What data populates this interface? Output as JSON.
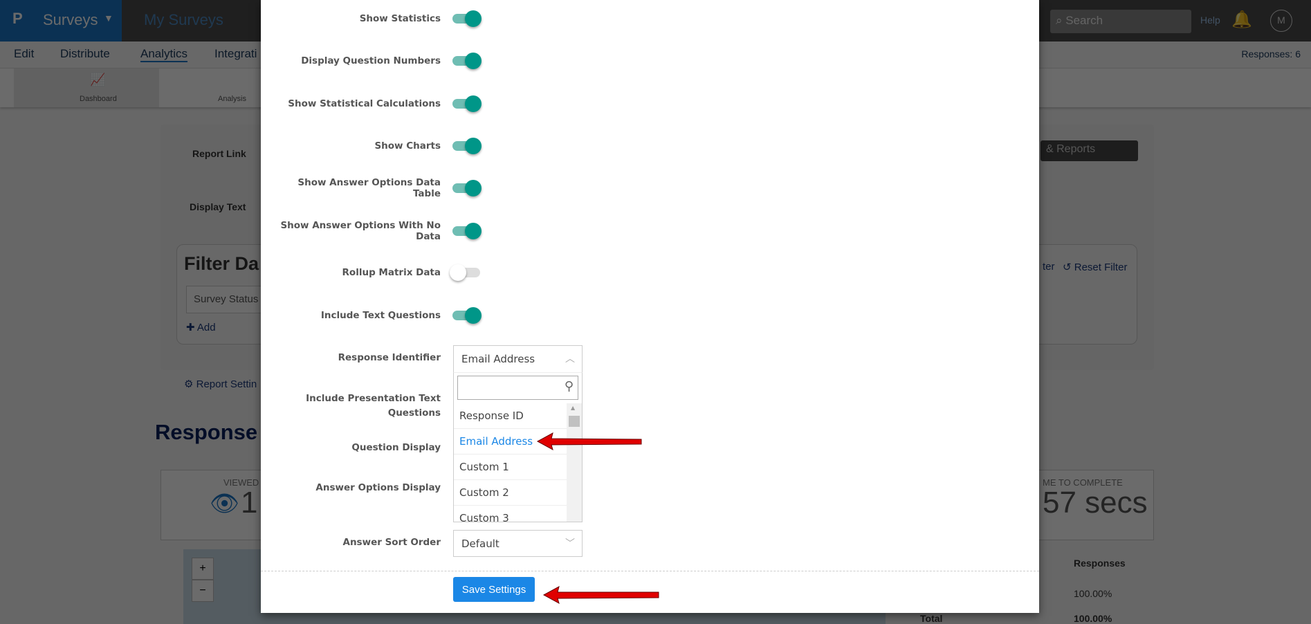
{
  "background": {
    "brand": "Surveys",
    "breadcrumb": "My Surveys",
    "search_placeholder": "Search",
    "help": "Help",
    "avatar": "M",
    "nav": [
      "Edit",
      "Distribute",
      "Analytics",
      "Integrati"
    ],
    "responses_count": "Responses: 6",
    "tools": [
      "Dashboard",
      "Analysis"
    ],
    "report_link_label": "Report Link",
    "display_text_label": "Display Text",
    "reports_button": "& Reports",
    "filter_title": "Filter Da",
    "survey_status": "Survey Status",
    "add": "Add",
    "reset_filter": "Reset Filter",
    "filter_partial": "ter",
    "report_settings": "Report Settin",
    "responses_heading": "Response",
    "viewed_label": "VIEWED",
    "viewed_value": "1",
    "time_label": "ME TO COMPLETE",
    "time_value": "57 secs",
    "table_header": "Responses",
    "table_value": "100.00%",
    "total_label": "Total",
    "total_value": "100.00%"
  },
  "modal": {
    "toggles": [
      {
        "label": "Show Statistics",
        "on": true
      },
      {
        "label": "Display Question Numbers",
        "on": true
      },
      {
        "label": "Show Statistical Calculations",
        "on": true
      },
      {
        "label": "Show Charts",
        "on": true
      },
      {
        "label": "Show Answer Options Data Table",
        "on": true
      },
      {
        "label": "Show Answer Options With No Data",
        "on": true
      },
      {
        "label": "Rollup Matrix Data",
        "on": false
      },
      {
        "label": "Include Text Questions",
        "on": true
      }
    ],
    "response_identifier": {
      "label": "Response Identifier",
      "value": "Email Address",
      "search_value": "",
      "options": [
        "Response ID",
        "Email Address",
        "Custom 1",
        "Custom 2",
        "Custom 3"
      ],
      "selected": "Email Address"
    },
    "include_presentation_label_1": "Include Presentation Text",
    "include_presentation_label_2": "Questions",
    "question_display_label": "Question Display",
    "answer_options_display_label": "Answer Options Display",
    "answer_sort_order": {
      "label": "Answer Sort Order",
      "value": "Default"
    },
    "save_button": "Save Settings",
    "colors": {
      "toggle_on": "#009688",
      "save": "#1b87e6",
      "selected_option": "#1b87e6",
      "annotation_arrow": "#e00000"
    }
  }
}
